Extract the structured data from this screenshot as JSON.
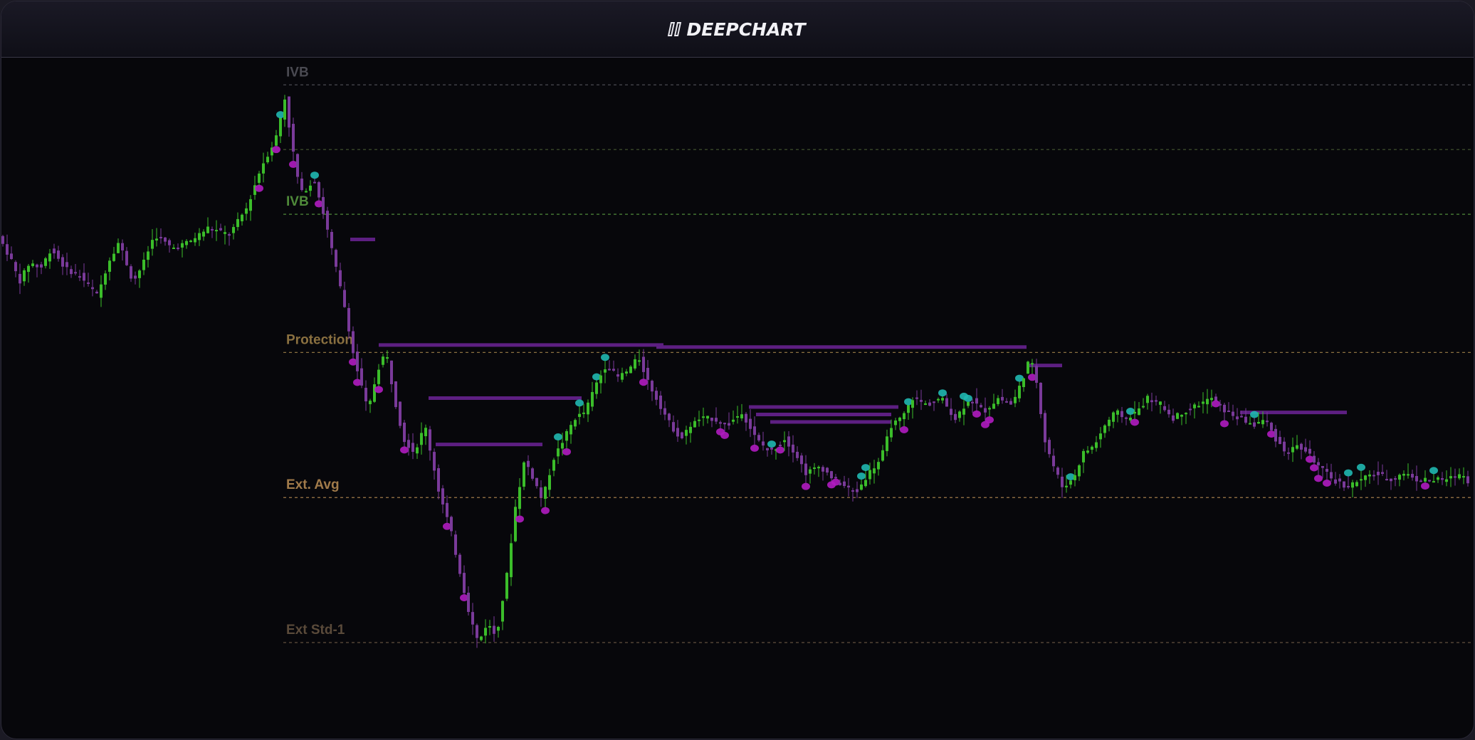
{
  "app": {
    "brand_name": "DEEPCHART",
    "logo_icon": "double-bar-logo-icon"
  },
  "colors": {
    "background": "#07070b",
    "up_candle": "#3bbd2a",
    "down_candle": "#7a3a9a",
    "cyan_marker": "#20b8b0",
    "magenta_marker": "#b01cc0",
    "zone_line": "#5d1f82"
  },
  "chart_data": {
    "type": "candlestick",
    "title": "",
    "xlabel": "",
    "ylabel": "",
    "grid": false,
    "ylim": [
      0,
      100
    ],
    "levels": [
      {
        "label": "IVB",
        "value": 96.0,
        "color": "#4a4a52"
      },
      {
        "label": "",
        "value": 86.5,
        "color": "#3b4a2a"
      },
      {
        "label": "IVB",
        "value": 77.0,
        "color": "#4f8a3a"
      },
      {
        "label": "Protection",
        "value": 56.7,
        "color": "#8a7040"
      },
      {
        "label": "Ext. Avg",
        "value": 35.4,
        "color": "#a07a4a"
      },
      {
        "label": "Ext Std-1",
        "value": 14.1,
        "color": "#5a4a3a"
      }
    ],
    "price_path": [
      [
        0,
        73
      ],
      [
        15,
        70
      ],
      [
        25,
        67
      ],
      [
        40,
        70
      ],
      [
        55,
        69
      ],
      [
        70,
        72
      ],
      [
        90,
        69
      ],
      [
        110,
        68
      ],
      [
        135,
        65
      ],
      [
        150,
        70
      ],
      [
        165,
        73
      ],
      [
        185,
        67
      ],
      [
        200,
        70
      ],
      [
        215,
        74
      ],
      [
        240,
        72
      ],
      [
        265,
        73
      ],
      [
        290,
        75
      ],
      [
        320,
        74
      ],
      [
        345,
        78
      ],
      [
        365,
        84
      ],
      [
        385,
        88
      ],
      [
        398,
        94
      ],
      [
        410,
        86
      ],
      [
        420,
        80
      ],
      [
        440,
        82
      ],
      [
        455,
        76
      ],
      [
        470,
        69
      ],
      [
        485,
        62
      ],
      [
        495,
        56
      ],
      [
        505,
        52
      ],
      [
        515,
        48
      ],
      [
        528,
        54
      ],
      [
        540,
        57
      ],
      [
        552,
        50
      ],
      [
        565,
        44
      ],
      [
        580,
        42
      ],
      [
        595,
        46
      ],
      [
        605,
        41
      ],
      [
        615,
        36
      ],
      [
        630,
        31
      ],
      [
        645,
        24
      ],
      [
        658,
        18
      ],
      [
        670,
        14
      ],
      [
        682,
        17
      ],
      [
        695,
        15
      ],
      [
        710,
        24
      ],
      [
        722,
        34
      ],
      [
        735,
        41
      ],
      [
        748,
        38
      ],
      [
        760,
        35
      ],
      [
        775,
        41
      ],
      [
        790,
        44
      ],
      [
        805,
        47
      ],
      [
        820,
        48
      ],
      [
        835,
        52
      ],
      [
        850,
        55
      ],
      [
        865,
        53
      ],
      [
        880,
        54
      ],
      [
        895,
        56
      ],
      [
        910,
        52
      ],
      [
        925,
        49
      ],
      [
        940,
        46
      ],
      [
        955,
        44
      ],
      [
        968,
        46
      ],
      [
        982,
        47
      ],
      [
        1000,
        47
      ],
      [
        1020,
        46
      ],
      [
        1040,
        48
      ],
      [
        1060,
        44
      ],
      [
        1080,
        42
      ],
      [
        1100,
        44
      ],
      [
        1115,
        42
      ],
      [
        1130,
        39
      ],
      [
        1150,
        40
      ],
      [
        1170,
        38
      ],
      [
        1185,
        37
      ],
      [
        1200,
        36
      ],
      [
        1218,
        39
      ],
      [
        1235,
        41
      ],
      [
        1250,
        46
      ],
      [
        1265,
        47
      ],
      [
        1280,
        50
      ],
      [
        1300,
        49
      ],
      [
        1320,
        50
      ],
      [
        1340,
        47
      ],
      [
        1360,
        50
      ],
      [
        1380,
        48
      ],
      [
        1400,
        50
      ],
      [
        1420,
        49
      ],
      [
        1435,
        53
      ],
      [
        1445,
        56
      ],
      [
        1455,
        52
      ],
      [
        1465,
        44
      ],
      [
        1478,
        40
      ],
      [
        1490,
        37
      ],
      [
        1505,
        38
      ],
      [
        1520,
        42
      ],
      [
        1535,
        43
      ],
      [
        1550,
        46
      ],
      [
        1565,
        48
      ],
      [
        1580,
        47
      ],
      [
        1595,
        48
      ],
      [
        1610,
        50
      ],
      [
        1630,
        49
      ],
      [
        1645,
        47
      ],
      [
        1660,
        48
      ],
      [
        1680,
        49
      ],
      [
        1700,
        50
      ],
      [
        1720,
        48
      ],
      [
        1740,
        47
      ],
      [
        1760,
        46
      ],
      [
        1775,
        47
      ],
      [
        1790,
        44
      ],
      [
        1805,
        42
      ],
      [
        1820,
        43
      ],
      [
        1835,
        42
      ],
      [
        1850,
        40
      ],
      [
        1870,
        38
      ],
      [
        1890,
        37
      ],
      [
        1910,
        38
      ],
      [
        1930,
        39
      ],
      [
        1950,
        38
      ],
      [
        1970,
        39
      ],
      [
        1990,
        38
      ],
      [
        2010,
        38
      ],
      [
        2030,
        38
      ],
      [
        2050,
        39
      ],
      [
        2068,
        37
      ]
    ],
    "zones": [
      {
        "x0": 490,
        "x1": 525,
        "y": 73.3
      },
      {
        "x0": 530,
        "x1": 930,
        "y": 57.8
      },
      {
        "x0": 600,
        "x1": 815,
        "y": 50.0
      },
      {
        "x0": 610,
        "x1": 760,
        "y": 43.2
      },
      {
        "x0": 920,
        "x1": 1440,
        "y": 57.5
      },
      {
        "x0": 1050,
        "x1": 1260,
        "y": 48.7
      },
      {
        "x0": 1060,
        "x1": 1250,
        "y": 47.6
      },
      {
        "x0": 1080,
        "x1": 1250,
        "y": 46.5
      },
      {
        "x0": 1440,
        "x1": 1490,
        "y": 54.8
      },
      {
        "x0": 1740,
        "x1": 1890,
        "y": 47.9
      }
    ]
  }
}
